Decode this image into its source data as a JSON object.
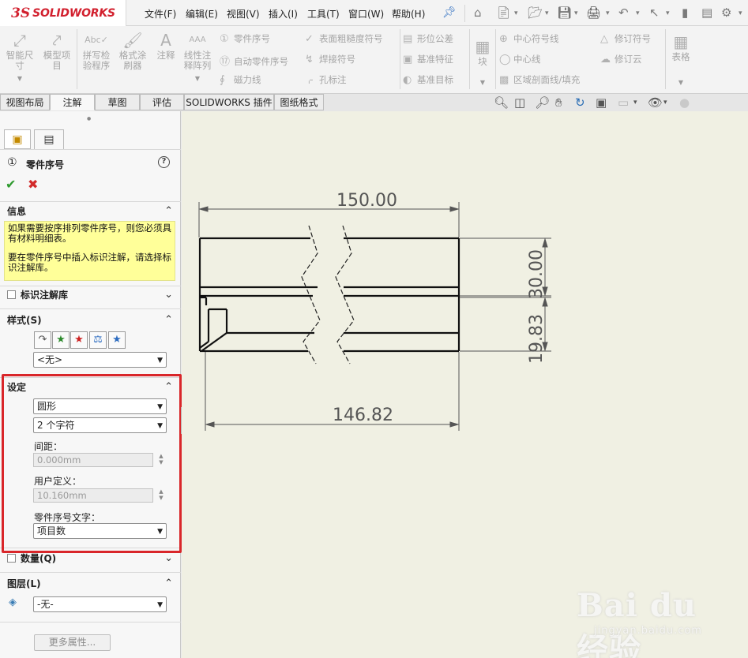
{
  "app": {
    "brand_prefix": "3S",
    "brand_name": "SOLIDWORKS"
  },
  "menu": {
    "items": [
      "文件(F)",
      "编辑(E)",
      "视图(V)",
      "插入(I)",
      "工具(T)",
      "窗口(W)",
      "帮助(H)"
    ]
  },
  "quick_access": {
    "icons": [
      "home-icon",
      "new-document-icon",
      "open-folder-icon",
      "save-icon",
      "print-icon",
      "undo-icon",
      "select-cursor-icon",
      "rebuild-icon",
      "options-icon"
    ]
  },
  "command_manager": {
    "smart_dimension": "智能尺寸",
    "model_items": "模型项目",
    "spell_checker": "拼写检验程序",
    "format_painter": "格式涂刷器",
    "note": "注释",
    "linear_note_pattern": "线性注释阵列",
    "balloon": "零件序号",
    "auto_balloon": "自动零件序号",
    "magnetic_line": "磁力线",
    "surface_finish": "表面粗糙度符号",
    "weld_symbol": "焊接符号",
    "hole_callout": "孔标注",
    "geometric_tolerance": "形位公差",
    "datum_feature": "基准特征",
    "datum_target": "基准目标",
    "block": "块",
    "center_mark": "中心符号线",
    "centerline": "中心线",
    "area_hatch": "区域剖面线/填充",
    "revision_symbol": "修订符号",
    "revision_cloud": "修订云",
    "table": "表格"
  },
  "tabs": [
    "视图布局",
    "注解",
    "草图",
    "评估",
    "SOLIDWORKS 插件",
    "图纸格式"
  ],
  "active_tab": "注解",
  "property_manager": {
    "title": "零件序号",
    "info": {
      "header": "信息",
      "line1": "如果需要按序排列零件序号，则您必须具有材料明细表。",
      "line2": "要在零件序号中插入标识注解，请选择标识注解库。"
    },
    "annotation_library": "标识注解库",
    "style": {
      "header": "样式(S)",
      "value": "<无>"
    },
    "settings": {
      "header": "设定",
      "shape": "圆形",
      "size": "2 个字符",
      "padding_label": "间距：",
      "padding_value": "0.000mm",
      "user_defined_label": "用户定义：",
      "user_defined_value": "10.160mm",
      "balloon_text_label": "零件序号文字：",
      "balloon_text_value": "项目数"
    },
    "quantity": "数量(Q)",
    "layer": {
      "header": "图层(L)",
      "value": "-无-"
    },
    "more_properties": "更多属性..."
  },
  "drawing": {
    "dim_top": "150.00",
    "dim_bottom": "146.82",
    "dim_right_outer": "30.00",
    "dim_right_inner": "19.83"
  },
  "watermark": {
    "main": "Bai du 经验",
    "sub": "jingyan.baidu.com"
  },
  "colors": {
    "brand_red": "#d2202e",
    "highlight_red": "#d9262a",
    "info_yellow": "#ffff99",
    "canvas": "#f0f0e3"
  }
}
